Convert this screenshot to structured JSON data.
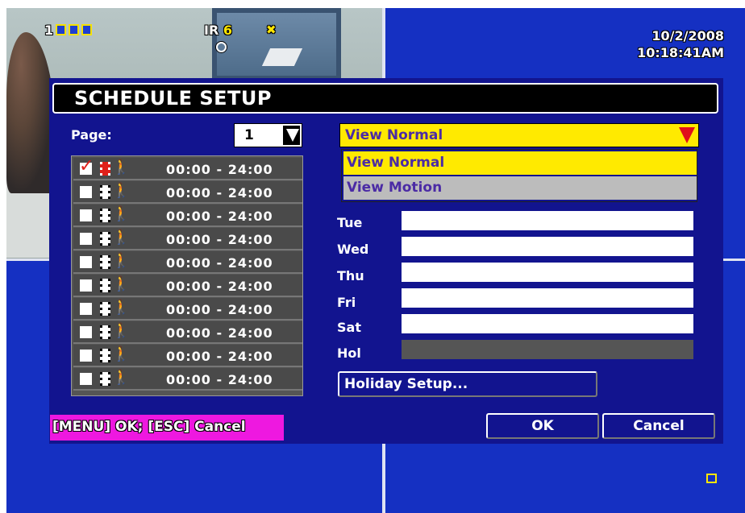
{
  "osd": {
    "channel_number": "1",
    "ir_label": "IR",
    "ir_value": "6",
    "date": "10/2/2008",
    "time": "10:18:41AM"
  },
  "dialog": {
    "title": "SCHEDULE SETUP",
    "page_label": "Page:",
    "page_value": "1",
    "schedule_rows": [
      {
        "enabled": true,
        "time": "00:00 - 24:00"
      },
      {
        "enabled": false,
        "time": "00:00 - 24:00"
      },
      {
        "enabled": false,
        "time": "00:00 - 24:00"
      },
      {
        "enabled": false,
        "time": "00:00 - 24:00"
      },
      {
        "enabled": false,
        "time": "00:00 - 24:00"
      },
      {
        "enabled": false,
        "time": "00:00 - 24:00"
      },
      {
        "enabled": false,
        "time": "00:00 - 24:00"
      },
      {
        "enabled": false,
        "time": "00:00 - 24:00"
      },
      {
        "enabled": false,
        "time": "00:00 - 24:00"
      },
      {
        "enabled": false,
        "time": "00:00 - 24:00"
      }
    ],
    "view_select": {
      "value": "View Normal",
      "options": [
        "View Normal",
        "View Motion"
      ]
    },
    "days": [
      "Tue",
      "Wed",
      "Thu",
      "Fri",
      "Sat",
      "Hol"
    ],
    "holiday_button": "Holiday Setup...",
    "ok_button": "OK",
    "cancel_button": "Cancel"
  },
  "hint": "[MENU] OK; [ESC] Cancel",
  "colors": {
    "dialog_bg": "#12148f",
    "screen_bg": "#1530c2",
    "selected": "#ffea00",
    "hint_bg": "#ee18e0",
    "accent_red": "#e0101a"
  }
}
